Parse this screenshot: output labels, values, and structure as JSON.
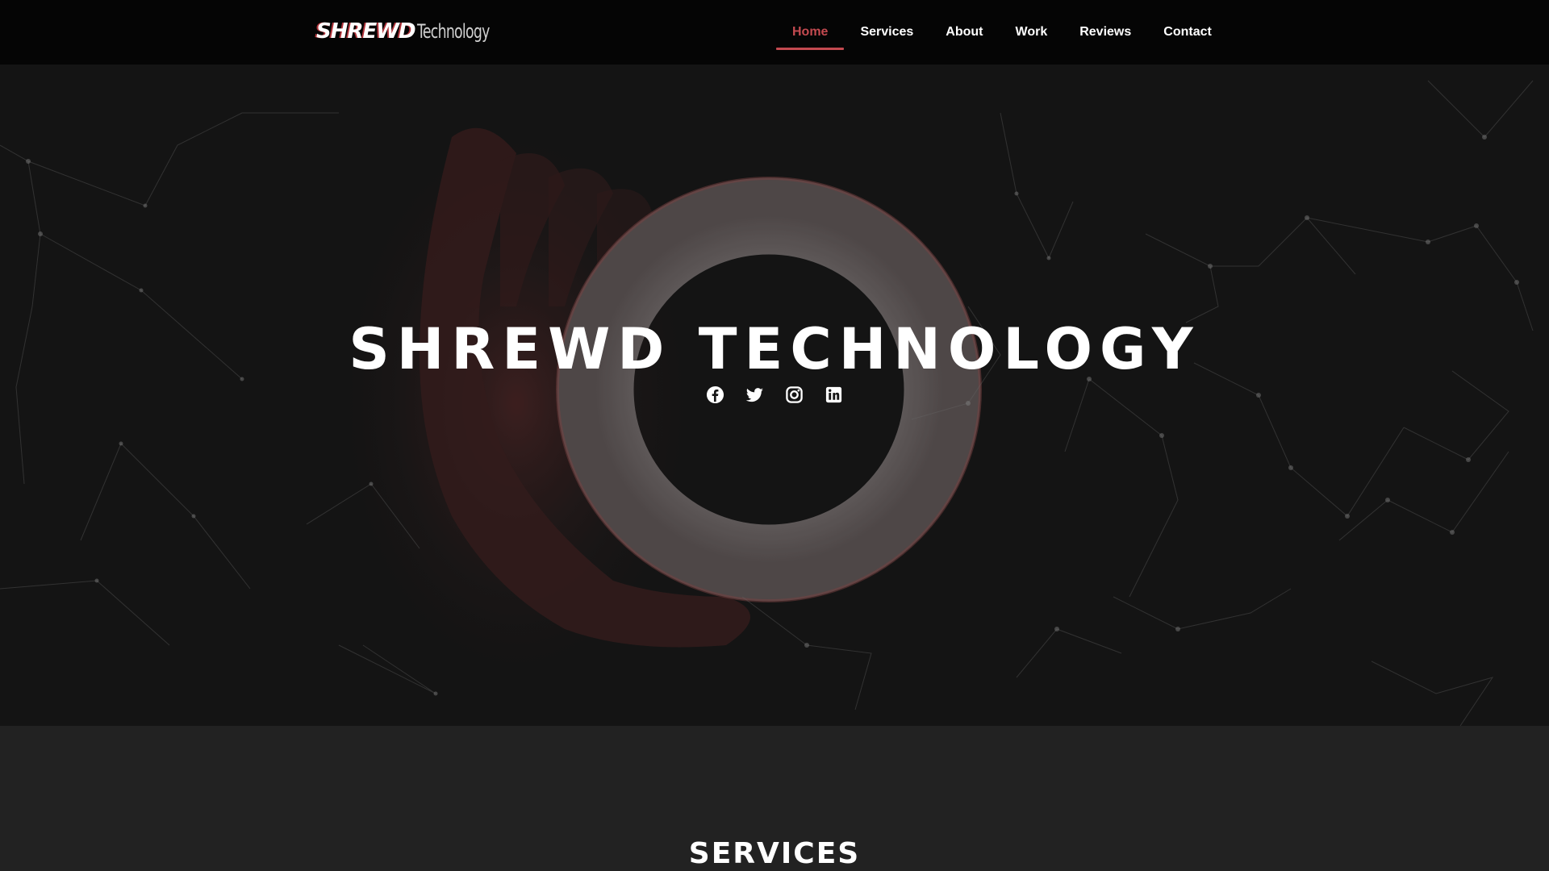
{
  "brand": {
    "name_part1": "SHREWD",
    "name_part2": "Technology",
    "accent_color": "#c44a50"
  },
  "nav": {
    "items": [
      {
        "label": "Home",
        "active": true
      },
      {
        "label": "Services",
        "active": false
      },
      {
        "label": "About",
        "active": false
      },
      {
        "label": "Work",
        "active": false
      },
      {
        "label": "Reviews",
        "active": false
      },
      {
        "label": "Contact",
        "active": false
      }
    ]
  },
  "hero": {
    "title": "SHREWD TECHNOLOGY",
    "social": [
      {
        "icon": "facebook-icon"
      },
      {
        "icon": "twitter-icon"
      },
      {
        "icon": "instagram-icon"
      },
      {
        "icon": "linkedin-icon"
      }
    ]
  },
  "services": {
    "title": "SERVICES"
  }
}
